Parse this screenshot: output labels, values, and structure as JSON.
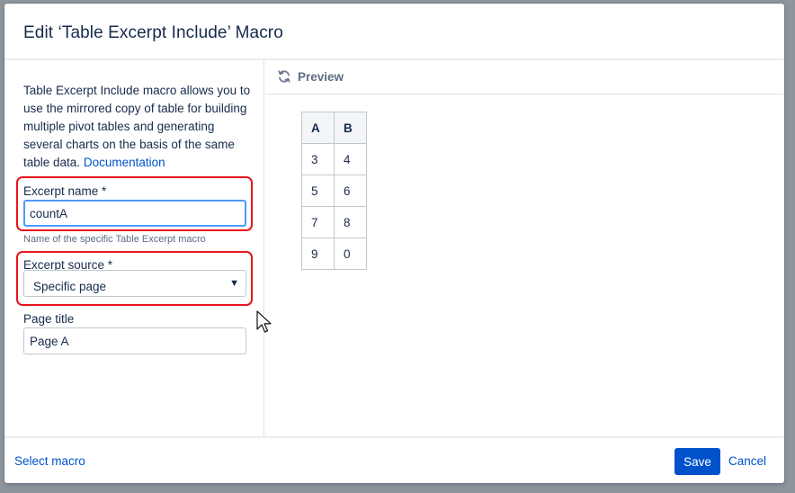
{
  "dialog": {
    "title": "Edit ‘Table Excerpt Include’ Macro"
  },
  "left_panel": {
    "description": "Table Excerpt Include macro allows you to use the mirrored copy of table for building multiple pivot tables and generating several charts on the basis of the same table data.",
    "documentation_link": "Documentation",
    "excerpt_name": {
      "label": "Excerpt name *",
      "value": "countA",
      "help": "Name of the specific Table Excerpt macro"
    },
    "excerpt_source": {
      "label": "Excerpt source *",
      "selected": "Specific page"
    },
    "page_title": {
      "label": "Page title",
      "value": "Page A"
    }
  },
  "preview": {
    "label": "Preview",
    "table": {
      "headers": [
        "A",
        "B"
      ],
      "rows": [
        [
          "3",
          "4"
        ],
        [
          "5",
          "6"
        ],
        [
          "7",
          "8"
        ],
        [
          "9",
          "0"
        ]
      ]
    }
  },
  "footer": {
    "select_macro": "Select macro",
    "save": "Save",
    "cancel": "Cancel"
  },
  "colors": {
    "primary": "#0052cc",
    "highlight": "#e8141c",
    "focus": "#4c9aff"
  },
  "icons": [
    "refresh-icon",
    "chevron-down-icon",
    "mouse-cursor-icon"
  ]
}
